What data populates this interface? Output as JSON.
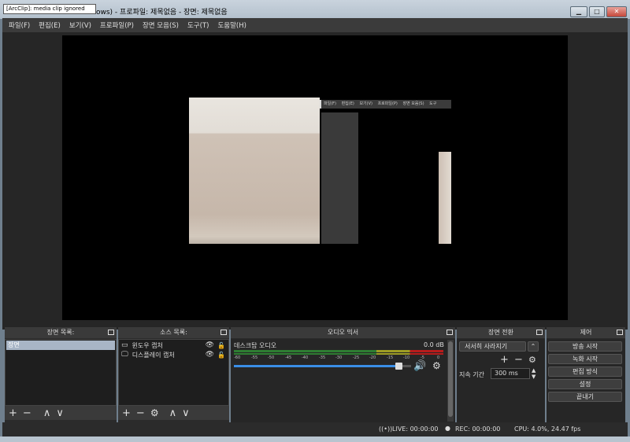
{
  "tooltip": "[ArcClip]: media clip ignored",
  "window": {
    "title": "ows) - 프로파일: 제목없음 - 장면: 제목없음",
    "minimize_icon": "minimize-icon",
    "maximize_icon": "maximize-icon",
    "close_icon": "close-icon"
  },
  "menu": [
    "파일(F)",
    "편집(E)",
    "보기(V)",
    "프로파일(P)",
    "장면 모음(S)",
    "도구(T)",
    "도움말(H)"
  ],
  "nested_menu": [
    "파일(F)",
    "편집(E)",
    "보기(V)",
    "프로파일(P)",
    "장면 모음(S)",
    "도구"
  ],
  "docks": {
    "scenes": {
      "title": "장면 목록:",
      "items": [
        "장면"
      ]
    },
    "sources": {
      "title": "소스 목록:",
      "items": [
        {
          "label": "윈도우 캡처",
          "icon": "window-icon"
        },
        {
          "label": "디스플레이 캡처",
          "icon": "monitor-icon"
        }
      ]
    },
    "mixer": {
      "title": "오디오 믹서",
      "channel": "데스크탑 오디오",
      "level": "0.0 dB",
      "ticks": [
        "-60",
        "-55",
        "-50",
        "-45",
        "-40",
        "-35",
        "-30",
        "-25",
        "-20",
        "-15",
        "-10",
        "-5",
        "0"
      ],
      "volume": 0.93
    },
    "transitions": {
      "title": "장면 전환",
      "selected": "서서히 사라지기",
      "duration_label": "지속 기간",
      "duration_value": "300 ms"
    },
    "controls": {
      "title": "제어",
      "buttons": [
        "방송 시작",
        "녹화 시작",
        "편집 방식",
        "설정",
        "끝내기"
      ]
    }
  },
  "status": {
    "live": "LIVE: 00:00:00",
    "rec": "REC: 00:00:00",
    "cpu": "CPU: 4.0%, 24.47 fps"
  },
  "colors": {
    "accent": "#a8b5c6",
    "slider": "#3a8ee6"
  }
}
